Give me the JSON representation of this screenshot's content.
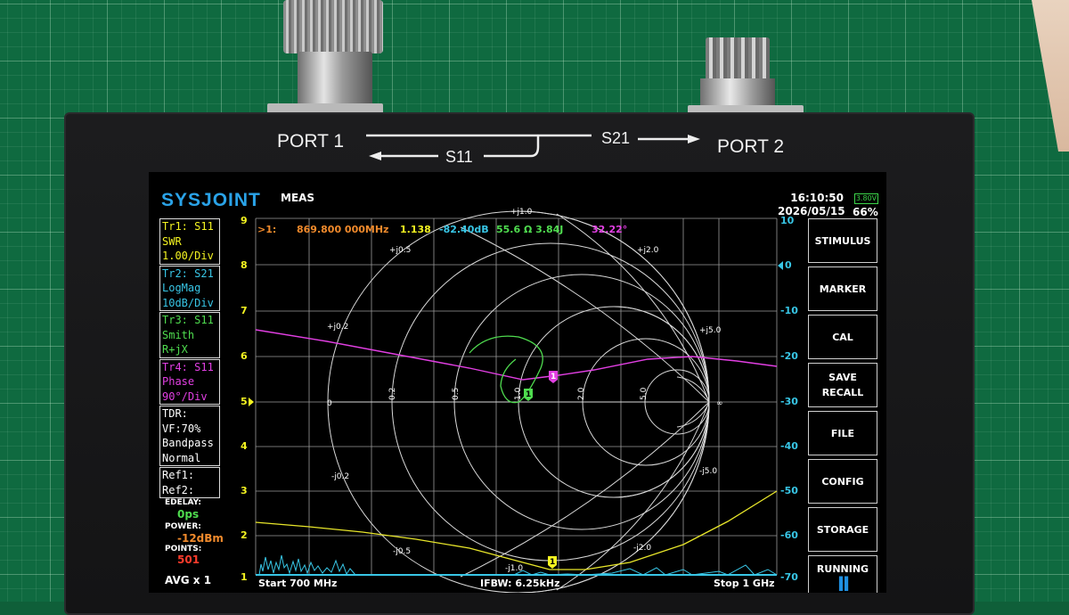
{
  "photo": {
    "port1_label": "PORT 1",
    "port2_label": "PORT 2",
    "s21_label": "S21",
    "s11_label": "S11"
  },
  "header": {
    "logo": "SYSJOINT",
    "mode": "MEAS",
    "time": "16:10:50",
    "date": "2026/05/15",
    "battery_voltage": "3.80V",
    "battery_percent": "66%"
  },
  "traces": [
    {
      "name": "Tr1:  S11",
      "format": "SWR",
      "scale": "1.00/Div",
      "color": "#f5f521"
    },
    {
      "name": "Tr2:  S21",
      "format": "LogMag",
      "scale": "10dB/Div",
      "color": "#38c6e6"
    },
    {
      "name": "Tr3:  S11",
      "format": "Smith",
      "scale": "R+jX",
      "color": "#4fdc4f"
    },
    {
      "name": "Tr4:  S11",
      "format": "Phase",
      "scale": "90°/Div",
      "color": "#e23fe3"
    }
  ],
  "tdr": {
    "title": "TDR:",
    "vf": "VF:70%",
    "mode": "Bandpass",
    "window": "Normal"
  },
  "refs": {
    "ref1": "Ref1:",
    "ref2": "Ref2:"
  },
  "settings": {
    "edelay_label": "EDELAY:",
    "edelay_value": "0ps",
    "power_label": "POWER:",
    "power_value": "-12dBm",
    "points_label": "POINTS:",
    "points_value": "501",
    "avg": "AVG x 1"
  },
  "marker": {
    "id": ">1:",
    "freq": "869.800 000MHz",
    "swr": "1.138",
    "logmag": "-82.40dB",
    "impedance": "55.6 Ω  3.84J",
    "phase": "32.22°"
  },
  "left_axis": [
    "9",
    "8",
    "7",
    "6",
    "5",
    "4",
    "3",
    "2",
    "1"
  ],
  "right_axis": [
    "10",
    "0",
    "-10",
    "-20",
    "-30",
    "-40",
    "-50",
    "-60",
    "-70"
  ],
  "smith_labels": {
    "top": "+j1.0",
    "up05": "+j0.5",
    "up2": "+j2.0",
    "up02": "+j0.2",
    "up5": "+j5.0",
    "zero": "0",
    "inf": "∞",
    "r02": "0.2",
    "r05": "0.5",
    "r10": "1.0",
    "r20": "2.0",
    "r50": "5.0",
    "dn02": "-j0.2",
    "dn5": "-j5.0",
    "dn05": "-j0.5",
    "dn2": "-j2.0",
    "bottom": "-j1.0"
  },
  "marker_badge": "1",
  "footer": {
    "start": "Start  700 MHz",
    "ifbw": "IFBW: 6.25kHz",
    "stop": "Stop  1 GHz"
  },
  "menu": {
    "stimulus": "STIMULUS",
    "marker": "MARKER",
    "cal": "CAL",
    "save": "SAVE",
    "recall": "RECALL",
    "file": "FILE",
    "config": "CONFIG",
    "storage": "STORAGE",
    "running": "RUNNING",
    "running_icon": "II"
  },
  "colors": {
    "swr": "#f5f521",
    "logmag": "#38c6e6",
    "smith": "#4fdc4f",
    "phase": "#e23fe3",
    "marker_text": "#f08a2c",
    "logo": "#2aa3e8"
  }
}
